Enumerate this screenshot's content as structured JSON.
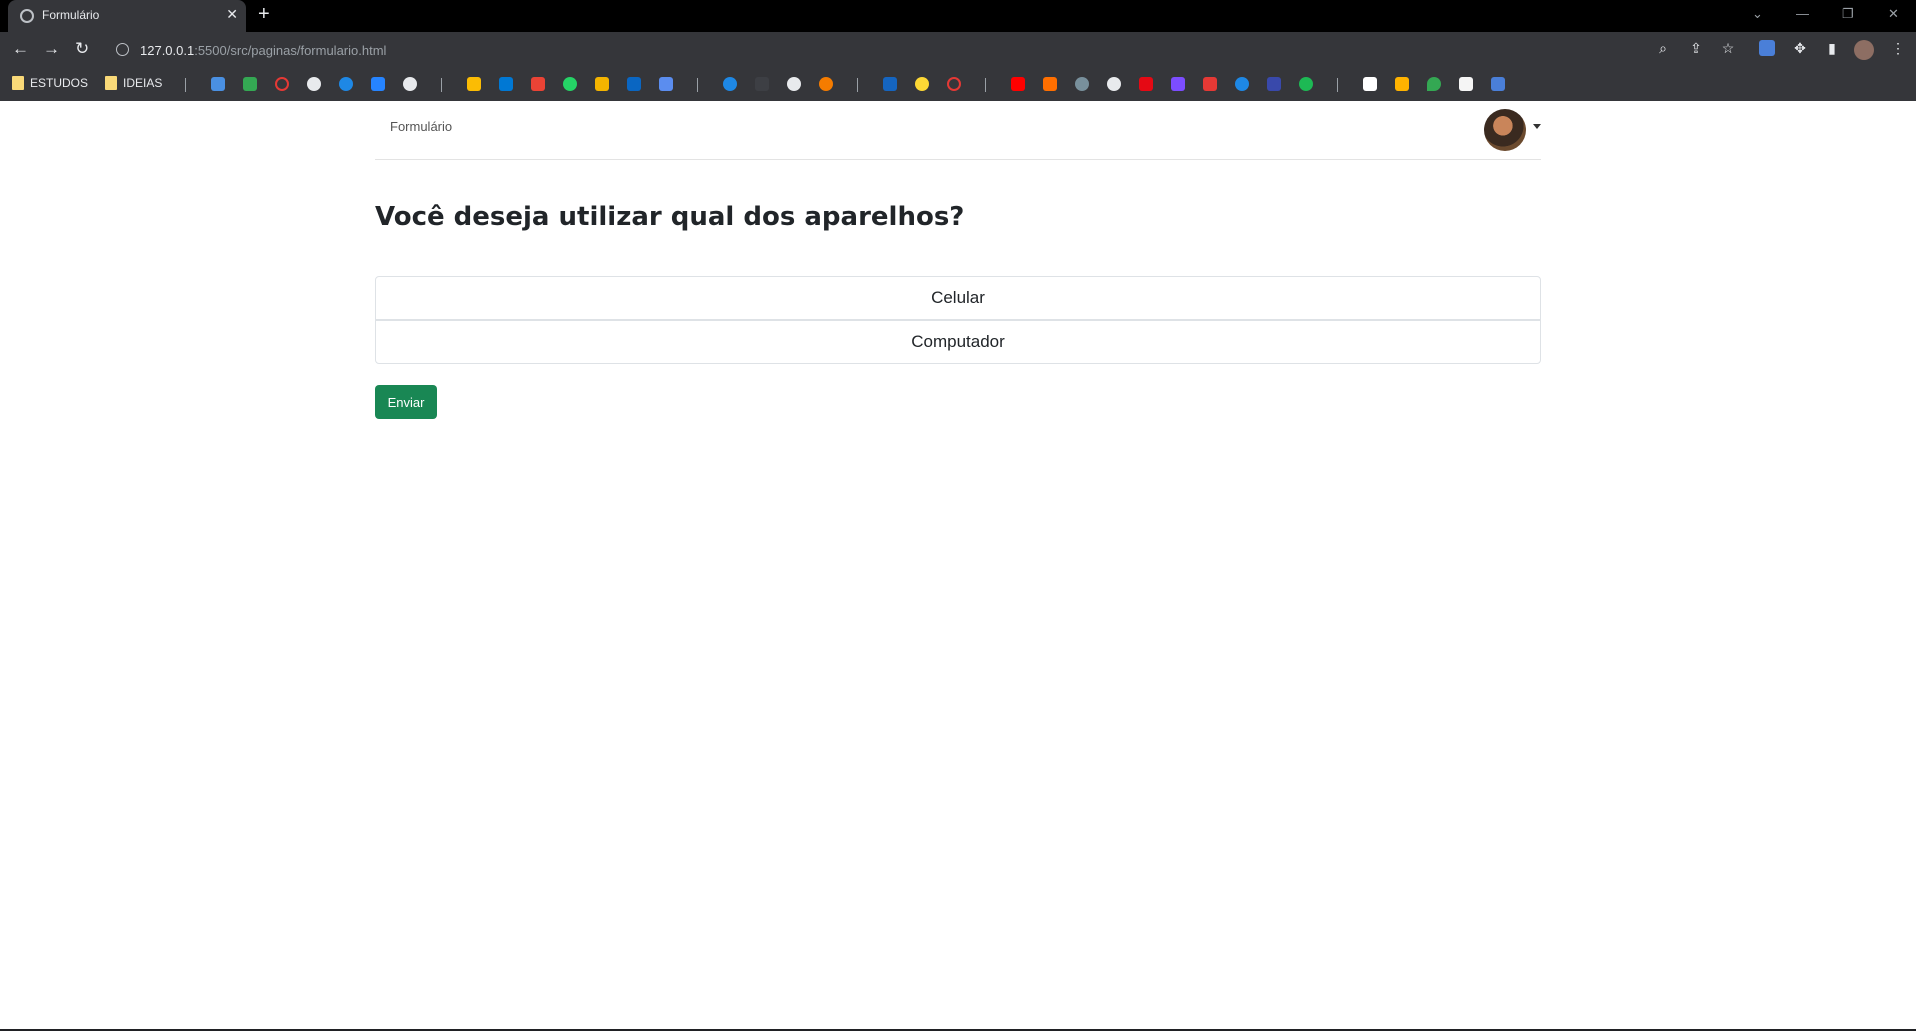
{
  "browser": {
    "tab_title": "Formulário",
    "tab_close": "✕",
    "new_tab": "+",
    "url_host": "127.0.0.1",
    "url_rest": ":5500/src/paginas/formulario.html"
  },
  "bookmarks": {
    "folders": [
      "ESTUDOS",
      "IDEIAS"
    ]
  },
  "navbar": {
    "brand": "Formulário"
  },
  "form": {
    "question": "Você deseja utilizar qual dos aparelhos?",
    "options": [
      "Celular",
      "Computador"
    ],
    "submit_label": "Enviar"
  },
  "colors": {
    "submit": "#198754"
  }
}
